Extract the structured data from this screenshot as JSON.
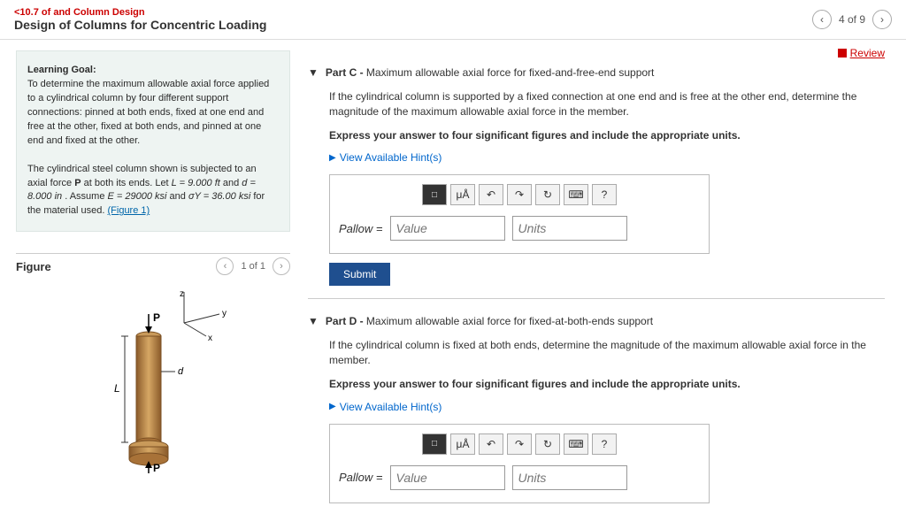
{
  "header": {
    "breadcrumb": "<10.7 of and Column Design",
    "title": "Design of Columns for Concentric Loading",
    "pager": "4 of 9"
  },
  "review_label": "Review",
  "learning": {
    "heading": "Learning Goal:",
    "p1": "To determine the maximum allowable axial force applied to a cylindrical column by four different support connections: pinned at both ends, fixed at one end and free at the other, fixed at both ends, and pinned at one end and fixed at the other.",
    "p2a": "The cylindrical steel column shown is subjected to an axial force ",
    "p2b": " at both its ends. Let ",
    "L": "L = 9.000 ft",
    "and1": " and ",
    "d": "d = 8.000 in",
    "p2c": " . Assume ",
    "E": "E = 29000 ksi",
    "and2": " and ",
    "sy": "σY = 36.00 ksi",
    "p2d": " for the material used.",
    "fig_link": "(Figure 1)"
  },
  "figure": {
    "label": "Figure",
    "pager": "1 of 1",
    "axis_x": "x",
    "axis_y": "y",
    "axis_z": "z",
    "P": "P",
    "L": "L",
    "d": "d"
  },
  "partC": {
    "title_bold": "Part C - ",
    "title_rest": "Maximum allowable axial force for fixed-and-free-end support",
    "prompt": "If the cylindrical column is supported by a fixed connection at one end and is free at the other end, determine the magnitude of the maximum allowable axial force in the member.",
    "instr": "Express your answer to four significant figures and include the appropriate units.",
    "hints": "View Available Hint(s)",
    "ans_label": "Pallow =",
    "value_ph": "Value",
    "units_ph": "Units",
    "submit": "Submit"
  },
  "partD": {
    "title_bold": "Part D - ",
    "title_rest": "Maximum allowable axial force for fixed-at-both-ends support",
    "prompt": "If the cylindrical column is fixed at both ends, determine the magnitude of the maximum allowable axial force in the member.",
    "instr": "Express your answer to four significant figures and include the appropriate units.",
    "hints": "View Available Hint(s)",
    "ans_label": "Pallow =",
    "value_ph": "Value",
    "units_ph": "Units"
  },
  "toolbar": {
    "t1": "□",
    "t2": "μÅ",
    "t3": "↶",
    "t4": "↷",
    "t5": "↻",
    "t6": "⌨",
    "t7": "?"
  }
}
